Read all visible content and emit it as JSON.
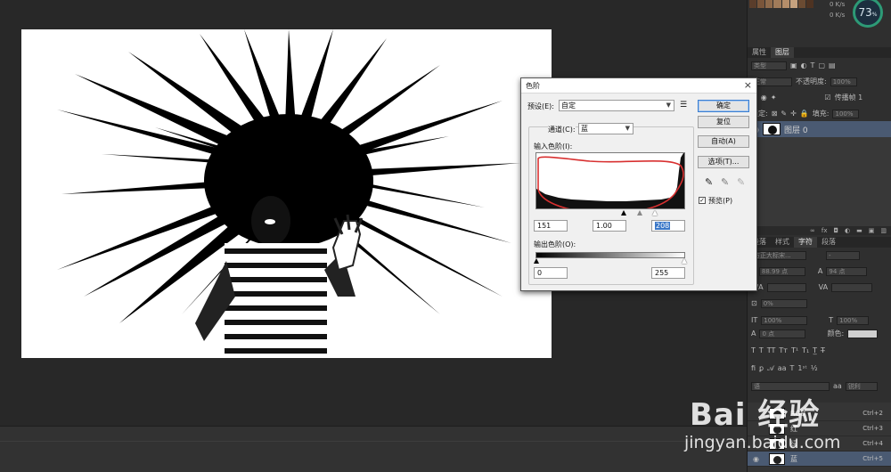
{
  "right_panel": {
    "net_up": "0 K/s",
    "net_down": "0 K/s",
    "cpu_value": "73",
    "cpu_unit": "%",
    "tabs_top": [
      "属性",
      "图层"
    ],
    "kind_label": "类型",
    "blend_mode": "正常",
    "opacity_label": "不透明度:",
    "opacity_value": "100%",
    "lock_label": "锁定:",
    "propagate_label": "传播帧 1",
    "fill_label": "填充:",
    "fill_value": "100%",
    "layer_name": "图层 0",
    "char_tabs": [
      "段落",
      "样式",
      "字符",
      "段落"
    ],
    "font_family": "方正大标宋...",
    "font_style": "-",
    "font_size": "88.99 点",
    "leading": "94 点",
    "tracking": "0%",
    "scale_v": "100%",
    "scale_h": "100%",
    "baseline": "0 点",
    "color_label": "颜色:",
    "language": "语",
    "aa_mode": "锐利",
    "channels": [
      {
        "name": "RGB",
        "shortcut": "Ctrl+2"
      },
      {
        "name": "红",
        "shortcut": "Ctrl+3"
      },
      {
        "name": "绿",
        "shortcut": "Ctrl+4"
      },
      {
        "name": "蓝",
        "shortcut": "Ctrl+5"
      }
    ]
  },
  "levels": {
    "title": "色阶",
    "preset_label": "预设(E):",
    "preset_value": "自定",
    "channel_label": "通道(C):",
    "channel_value": "蓝",
    "input_label": "输入色阶(I):",
    "input_black": "151",
    "input_gamma": "1.00",
    "input_white": "208",
    "output_label": "输出色阶(O):",
    "output_black": "0",
    "output_white": "255",
    "btn_ok": "确定",
    "btn_reset": "复位",
    "btn_auto": "自动(A)",
    "btn_options": "选项(T)...",
    "preview_label": "预览(P)",
    "preview_checked": "✓"
  },
  "watermark": {
    "logo": "Bai 经验",
    "url": "jingyan.baidu.com"
  }
}
